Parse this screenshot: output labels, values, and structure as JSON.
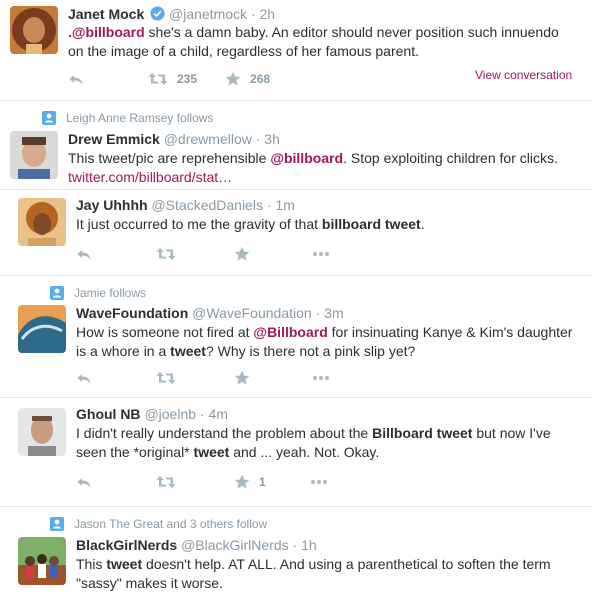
{
  "tweets": [
    {
      "name": "Janet Mock",
      "handle": "@janetmock",
      "time": "2h",
      "text_mention": ".@billboard",
      "text_rest": " she's a damn baby. An editor should never position such innuendo on the image of a child, regardless of her famous parent.",
      "retweets": "235",
      "favorites": "268",
      "view_conversation": "View conversation"
    },
    {
      "context": "Leigh Anne Ramsey follows",
      "name": "Drew Emmick",
      "handle": "@drewmellow",
      "time": "3h",
      "text_a": "This tweet/pic are reprehensible ",
      "text_mention": "@billboard",
      "text_b": ". Stop exploiting children for clicks.",
      "link": "twitter.com/billboard/stat…"
    },
    {
      "name": "Jay Uhhhh",
      "handle": "@StackedDaniels",
      "time": "1m",
      "text_a": "It just occurred to me the gravity of that ",
      "text_bold": "billboard tweet",
      "text_b": "."
    },
    {
      "context": "Jamie follows",
      "name": "WaveFoundation",
      "handle": "@WaveFoundation",
      "time": "3m",
      "text_a": "How is someone not fired at ",
      "text_mention": "@Billboard",
      "text_b": " for insinuating Kanye & Kim's daughter is a whore in a ",
      "text_bold": "tweet",
      "text_c": "? Why is there not a pink slip yet?"
    },
    {
      "name": "Ghoul NB",
      "handle": "@joelnb",
      "time": "4m",
      "text_a": "I didn't really understand the problem about the ",
      "text_bold1": "Billboard tweet",
      "text_b": " but now I've seen the *original* ",
      "text_bold2": "tweet",
      "text_c": " and ... yeah. Not. Okay.",
      "favorites": "1"
    },
    {
      "context": "Jason The Great and 3 others follow",
      "name": "BlackGirlNerds",
      "handle": "@BlackGirlNerds",
      "time": "1h",
      "text_a": "This ",
      "text_bold": "tweet",
      "text_b": " doesn't help. AT ALL. And using a parenthetical to soften the term \"sassy\" makes it worse."
    }
  ],
  "dot": "·",
  "colors": {
    "accent": "#9c1a5b",
    "muted": "#8899a6",
    "icon": "#aab8c2",
    "verified": "#55acee"
  },
  "icons": [
    "reply-icon",
    "retweet-icon",
    "favorite-icon",
    "more-icon",
    "verified-icon",
    "person-follow-icon"
  ]
}
